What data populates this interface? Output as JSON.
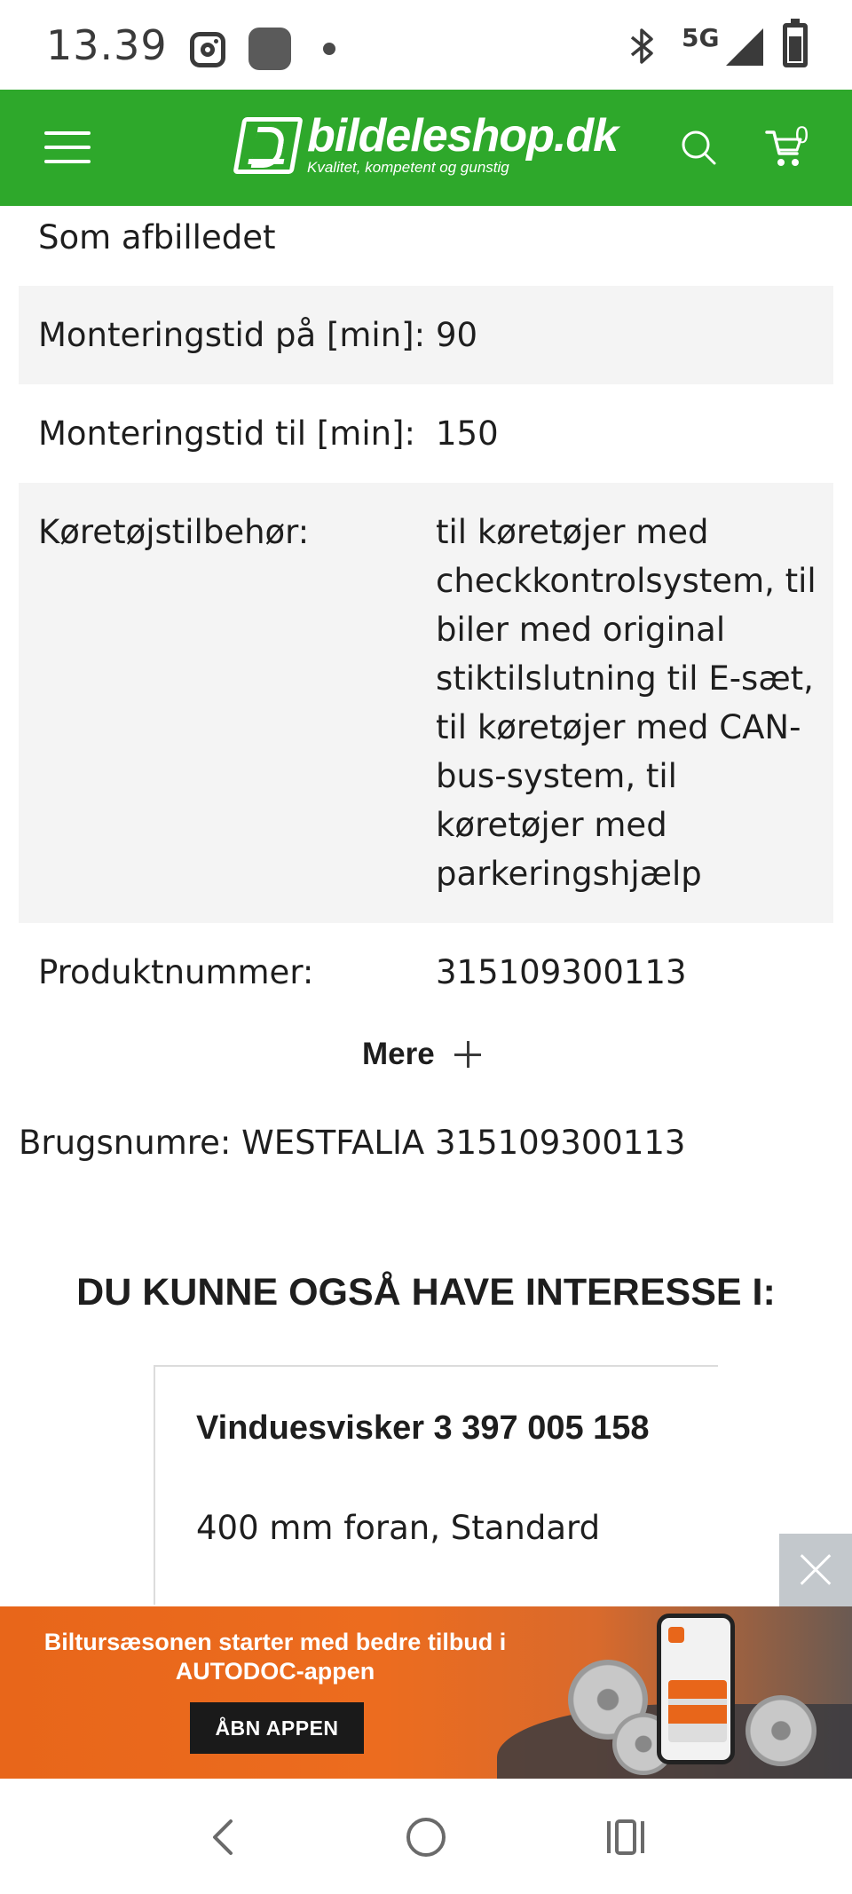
{
  "status_bar": {
    "time": "13.39",
    "network": "5G",
    "icons": [
      "instagram-icon",
      "app-icon",
      "notification-dot-icon",
      "bluetooth-icon",
      "signal-icon",
      "battery-icon"
    ]
  },
  "header": {
    "brand_name": "bildeleshop.dk",
    "tagline": "Kvalitet, kompetent og gunstig",
    "cart_count": "0",
    "background_color": "#2ea82b",
    "icons": [
      "menu-icon",
      "logo-icon",
      "search-icon",
      "cart-icon"
    ]
  },
  "specs": {
    "top_value": "Som afbilledet",
    "rows": [
      {
        "label": "Monteringstid på [min]:",
        "value": "90"
      },
      {
        "label": "Monteringstid til [min]:",
        "value": "150"
      },
      {
        "label": "Køretøjstilbehør:",
        "value": "til køretøjer med checkkontrolsystem, til biler med original stiktilslutning til E-sæt, til køretøjer med CAN-bus-system, til køretøjer med parkeringshjælp"
      },
      {
        "label": "Produktnummer:",
        "value": "315109300113"
      }
    ],
    "more_label": "Mere"
  },
  "brugsnumre": "Brugsnumre: WESTFALIA 315109300113",
  "recommendations": {
    "heading": "DU KUNNE OGSÅ HAVE INTERESSE I:",
    "products": [
      {
        "title": "Vinduesvisker 3 397 005 158",
        "description": "400 mm foran, Standard"
      }
    ]
  },
  "promo_banner": {
    "text": "Biltursæsonen starter med bedre tilbud i AUTODOC-appen",
    "button_label": "ÅBN APPEN",
    "accent_color": "#e8661a"
  },
  "nav_bar": {
    "icons": [
      "back-icon",
      "home-icon",
      "recents-icon"
    ]
  }
}
